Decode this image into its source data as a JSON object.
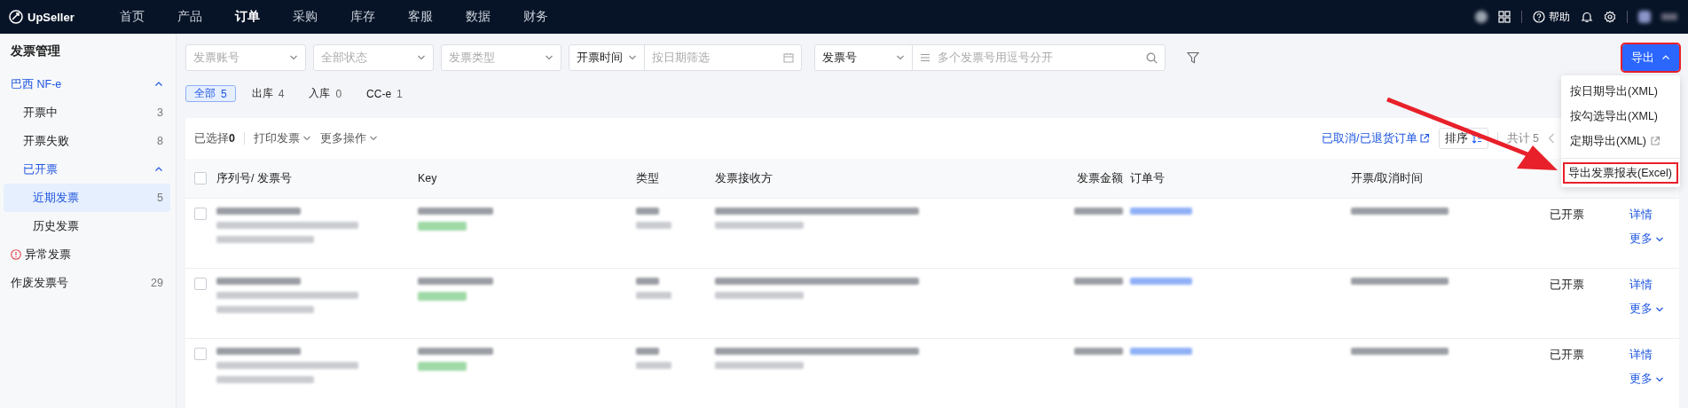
{
  "nav": {
    "logo": "UpSeller",
    "help": "帮助",
    "items": [
      {
        "label": "首页",
        "selected": false
      },
      {
        "label": "产品",
        "selected": false
      },
      {
        "label": "订单",
        "selected": true
      },
      {
        "label": "采购",
        "selected": false
      },
      {
        "label": "库存",
        "selected": false
      },
      {
        "label": "客服",
        "selected": false
      },
      {
        "label": "数据",
        "selected": false
      },
      {
        "label": "财务",
        "selected": false
      }
    ]
  },
  "sidebar": {
    "title": "发票管理",
    "items": [
      {
        "label": "巴西 NF-e",
        "kind": "group",
        "expanded": true,
        "selected": false,
        "children": [
          {
            "label": "开票中",
            "kind": "item",
            "selected": false,
            "count": "3"
          },
          {
            "label": "开票失败",
            "kind": "item",
            "selected": false,
            "count": "8"
          },
          {
            "label": "已开票",
            "kind": "group",
            "expanded": true,
            "selected": false,
            "children": [
              {
                "label": "近期发票",
                "kind": "item",
                "selected": true,
                "count": "5"
              },
              {
                "label": "历史发票",
                "kind": "item",
                "selected": false
              }
            ]
          }
        ]
      },
      {
        "label": "异常发票",
        "kind": "alert",
        "selected": false
      },
      {
        "label": "作废发票号",
        "kind": "item",
        "selected": false,
        "count": "29"
      }
    ]
  },
  "filters": {
    "account": {
      "placeholder": "发票账号"
    },
    "status": {
      "placeholder": "全部状态"
    },
    "type": {
      "placeholder": "发票类型"
    },
    "date_mode": "开票时间",
    "date": {
      "placeholder": "按日期筛选"
    },
    "search_mode": "发票号",
    "search": {
      "placeholder": "多个发票号用逗号分开"
    }
  },
  "export": {
    "label": "导出",
    "open": true,
    "highlighted": true,
    "menu": [
      {
        "label": "按日期导出(XML)",
        "external": false,
        "divider_before": false,
        "highlighted": false
      },
      {
        "label": "按勾选导出(XML)",
        "external": false,
        "divider_before": false,
        "highlighted": false
      },
      {
        "label": "定期导出(XML)",
        "external": true,
        "divider_before": false,
        "highlighted": false
      },
      {
        "label": "导出发票报表(Excel)",
        "external": false,
        "divider_before": true,
        "highlighted": true
      }
    ]
  },
  "tabs": [
    {
      "label": "全部",
      "count": "5",
      "selected": true
    },
    {
      "label": "出库",
      "count": "4",
      "selected": false
    },
    {
      "label": "入库",
      "count": "0",
      "selected": false
    },
    {
      "label": "CC-e",
      "count": "1",
      "selected": false
    }
  ],
  "toolbar": {
    "selected": "已选择**0**",
    "actions": [
      "打印发票",
      "更多操作"
    ],
    "link": "已取消/已退货订单",
    "sort": "排序",
    "total": "共计 5"
  },
  "table": {
    "select_all_checked": false,
    "columns": [
      "序列号/ 发票号",
      "Key",
      "类型",
      "发票接收方",
      "发票金额",
      "订单号",
      "开票/取消时间"
    ],
    "rows": [
      {
        "checked": false,
        "status": "已开票",
        "actions": [
          "详情",
          "更多"
        ]
      },
      {
        "checked": false,
        "status": "已开票",
        "actions": [
          "详情",
          "更多"
        ]
      },
      {
        "checked": false,
        "status": "已开票",
        "actions": [
          "详情",
          "更多"
        ]
      }
    ]
  },
  "annotation_arrow": true
}
